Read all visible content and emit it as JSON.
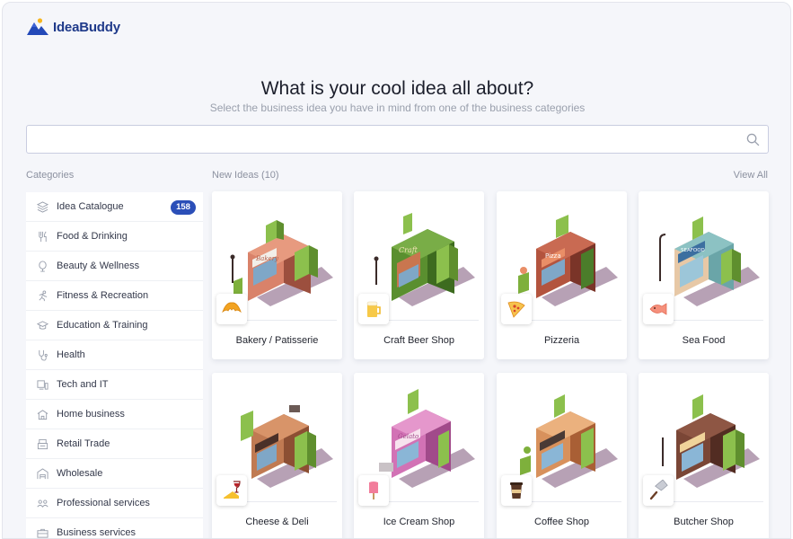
{
  "brand": {
    "name": "IdeaBuddy",
    "color": "#1f3a8a",
    "accent": "#2b4fb8"
  },
  "heading": {
    "title": "What is your cool idea all about?",
    "subtitle": "Select the business idea you have in mind from one of the business categories"
  },
  "search": {
    "value": "",
    "placeholder": ""
  },
  "sidebar": {
    "title": "Categories",
    "items": [
      {
        "label": "Idea Catalogue",
        "icon": "layers-icon",
        "badge": "158"
      },
      {
        "label": "Food & Drinking",
        "icon": "cutlery-icon"
      },
      {
        "label": "Beauty & Wellness",
        "icon": "mirror-icon"
      },
      {
        "label": "Fitness & Recreation",
        "icon": "runner-icon"
      },
      {
        "label": "Education & Training",
        "icon": "graduation-cap-icon"
      },
      {
        "label": "Health",
        "icon": "stethoscope-icon"
      },
      {
        "label": "Tech and IT",
        "icon": "devices-icon"
      },
      {
        "label": "Home business",
        "icon": "house-icon"
      },
      {
        "label": "Retail Trade",
        "icon": "register-icon"
      },
      {
        "label": "Wholesale",
        "icon": "warehouse-icon"
      },
      {
        "label": "Professional services",
        "icon": "people-icon"
      },
      {
        "label": "Business services",
        "icon": "briefcase-icon"
      }
    ]
  },
  "ideas": {
    "title": "New Ideas (10)",
    "view_all": "View All",
    "cards": [
      {
        "name": "Bakery / Patisserie",
        "emblem": "croissant-icon",
        "building": "#d9826a",
        "sign": "Bakery"
      },
      {
        "name": "Craft Beer Shop",
        "emblem": "beer-mug-icon",
        "building": "#5a8f2f",
        "sign": "Craft"
      },
      {
        "name": "Pizzeria",
        "emblem": "pizza-slice-icon",
        "building": "#b3543e",
        "sign": "Pizza"
      },
      {
        "name": "Sea Food",
        "emblem": "fish-icon",
        "building": "#6aa5a8",
        "sign": "SEAFOOD"
      },
      {
        "name": "Cheese & Deli",
        "emblem": "cheese-wine-icon",
        "building": "#c07a52",
        "sign": ""
      },
      {
        "name": "Ice Cream Shop",
        "emblem": "ice-pop-icon",
        "building": "#d272b5",
        "sign": "Gelato"
      },
      {
        "name": "Coffee Shop",
        "emblem": "coffee-cup-icon",
        "building": "#d8915c",
        "sign": ""
      },
      {
        "name": "Butcher Shop",
        "emblem": "cleaver-icon",
        "building": "#7a4636",
        "sign": ""
      }
    ]
  }
}
